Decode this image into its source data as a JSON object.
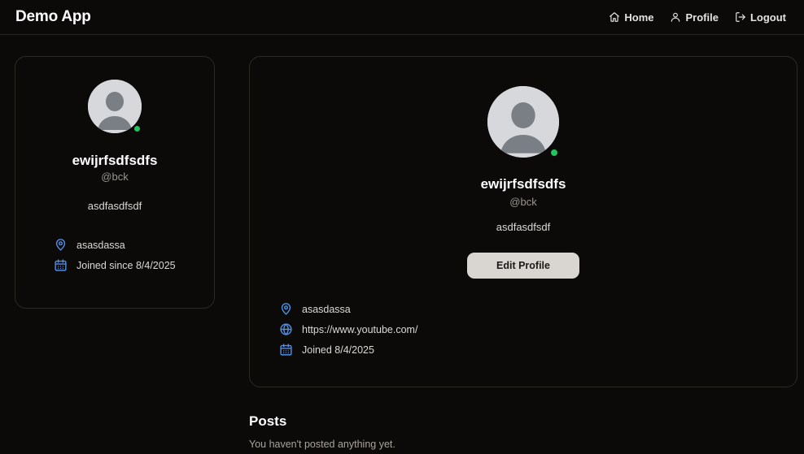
{
  "navbar": {
    "brand": "Demo App",
    "links": [
      {
        "label": "Home",
        "icon": "home-icon"
      },
      {
        "label": "Profile",
        "icon": "user-icon"
      },
      {
        "label": "Logout",
        "icon": "logout-icon"
      }
    ]
  },
  "user": {
    "name": "ewijrfsdfsdfs",
    "handle": "@bck",
    "bio": "asdfasdfsdf",
    "location": "asasdassa",
    "website": "https://www.youtube.com/",
    "online": true
  },
  "side_card": {
    "joined_text": "Joined since 8/4/2025"
  },
  "main_card": {
    "edit_button": "Edit Profile",
    "joined_text": "Joined 8/4/2025"
  },
  "posts": {
    "title": "Posts",
    "empty_message": "You haven't posted anything yet."
  },
  "colors": {
    "background": "#0b0a09",
    "accent_icon": "#4f8fe6",
    "online_dot": "#22c55e",
    "button_bg": "#d9d6d1"
  }
}
